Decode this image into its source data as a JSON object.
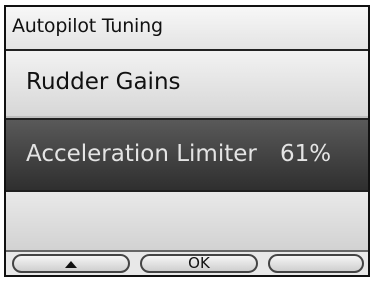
{
  "title": "Autopilot Tuning",
  "menu": {
    "items": [
      {
        "label": "Rudder Gains"
      },
      {
        "label": "Acceleration Limiter",
        "value": "61%"
      },
      {
        "label": ""
      }
    ]
  },
  "softkeys": {
    "left": "^",
    "center": "OK",
    "right": ""
  }
}
